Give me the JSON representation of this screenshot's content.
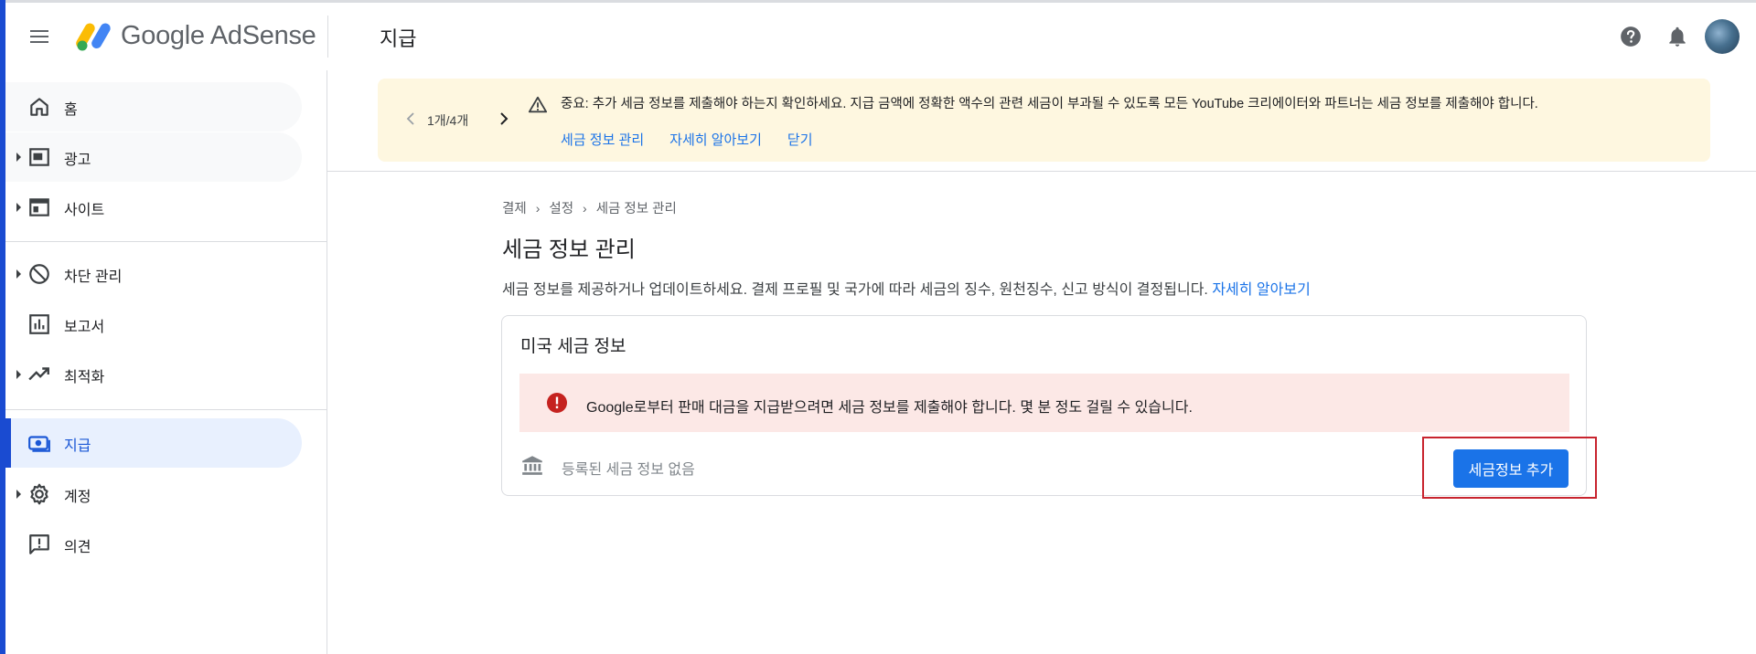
{
  "header": {
    "brand": "Google AdSense",
    "page_title": "지급"
  },
  "sidebar": {
    "items": [
      {
        "label": "홈",
        "icon": "home-icon"
      },
      {
        "label": "광고",
        "icon": "ads-icon"
      },
      {
        "label": "사이트",
        "icon": "sites-icon"
      },
      {
        "label": "차단 관리",
        "icon": "block-icon"
      },
      {
        "label": "보고서",
        "icon": "reports-icon"
      },
      {
        "label": "최적화",
        "icon": "optimization-icon"
      },
      {
        "label": "지급",
        "icon": "payments-icon"
      },
      {
        "label": "계정",
        "icon": "account-icon"
      },
      {
        "label": "의견",
        "icon": "feedback-icon"
      }
    ]
  },
  "banner": {
    "pager": "1개/4개",
    "text": "중요: 추가 세금 정보를 제출해야 하는지 확인하세요. 지급 금액에 정확한 액수의 관련 세금이 부과될 수 있도록 모든 YouTube 크리에이터와 파트너는 세금 정보를 제출해야 합니다.",
    "links": [
      "세금 정보 관리",
      "자세히 알아보기",
      "닫기"
    ]
  },
  "breadcrumb": [
    "결제",
    "설정",
    "세금 정보 관리"
  ],
  "main": {
    "title": "세금 정보 관리",
    "description": "세금 정보를 제공하거나 업데이트하세요. 결제 프로필 및 국가에 따라 세금의 징수, 원천징수, 신고 방식이 결정됩니다.",
    "description_link": "자세히 알아보기"
  },
  "card": {
    "title": "미국 세금 정보",
    "error": "Google로부터 판매 대금을 지급받으려면 세금 정보를 제출해야 합니다. 몇 분 정도 걸릴 수 있습니다.",
    "empty_text": "등록된 세금 정보 없음",
    "add_button": "세금정보 추가"
  },
  "colors": {
    "accent": "#1a73e8",
    "active_nav_bg": "#e8f0fe",
    "banner_bg": "#fef7e0",
    "error_bg": "#fce8e6",
    "error_icon": "#c5221f",
    "highlight_border": "#c8242e"
  }
}
